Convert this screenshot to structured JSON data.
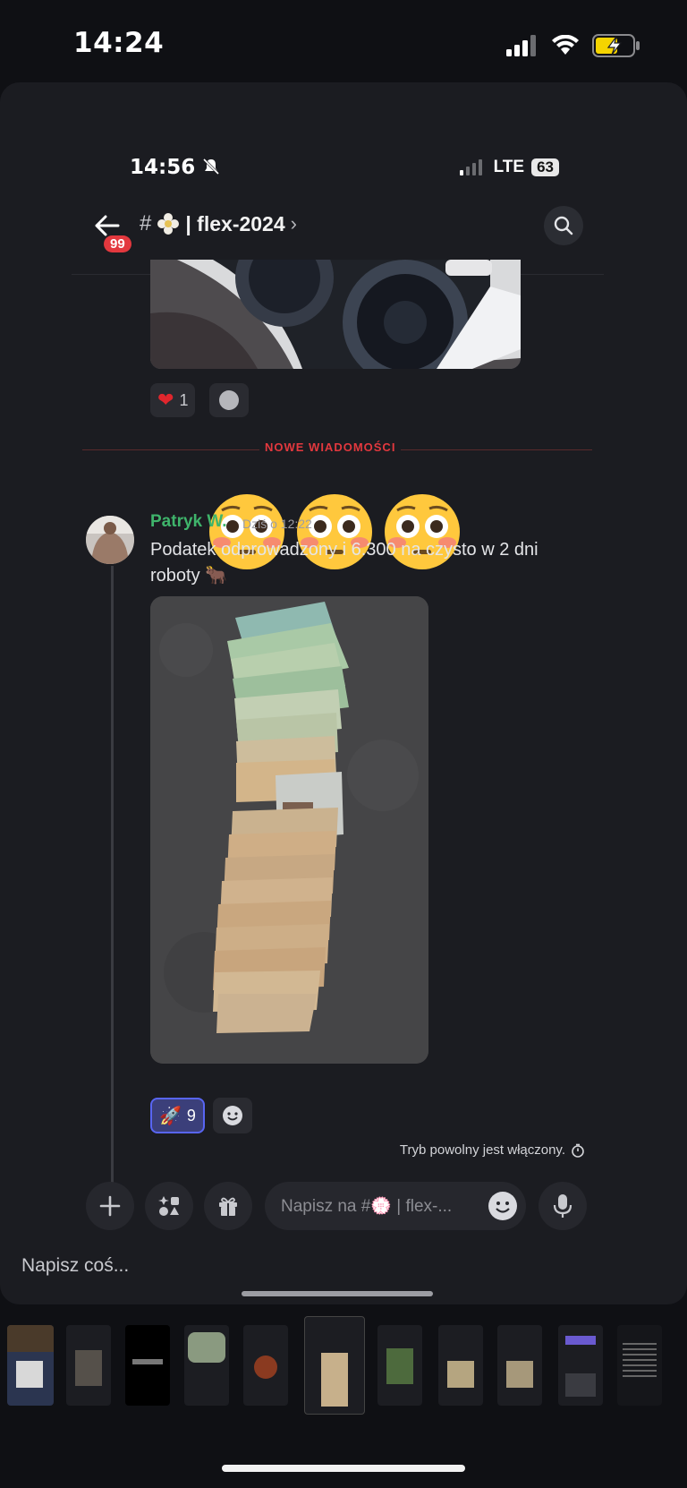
{
  "outer_status": {
    "time": "14:24"
  },
  "inner_status": {
    "time": "14:56",
    "network": "LTE",
    "battery": "63"
  },
  "channel": {
    "unread_badge": "99",
    "name": "| flex-2024",
    "chevron": "›"
  },
  "first_message": {
    "reaction_heart_count": "1"
  },
  "divider": {
    "label": "NOWE WIADOMOŚCI"
  },
  "overlay": {
    "emojis": [
      "😳",
      "😳",
      "😳"
    ]
  },
  "message": {
    "author": "Patryk W.",
    "timestamp": "Dziś o 12:22",
    "text": "Podatek odprowadzony i 6.300 na czysto w 2 dni roboty 🐂",
    "reaction_rocket_count": "9"
  },
  "slowmode": {
    "text": "Tryb powolny jest włączony."
  },
  "composer": {
    "placeholder": "Napisz na #💮 | flex-..."
  },
  "below_sheet": {
    "napisz": "Napisz coś..."
  },
  "colors": {
    "author": "#3fb46b",
    "badge": "#e3383e",
    "background": "#0f1014",
    "sheet": "#1b1c21"
  }
}
